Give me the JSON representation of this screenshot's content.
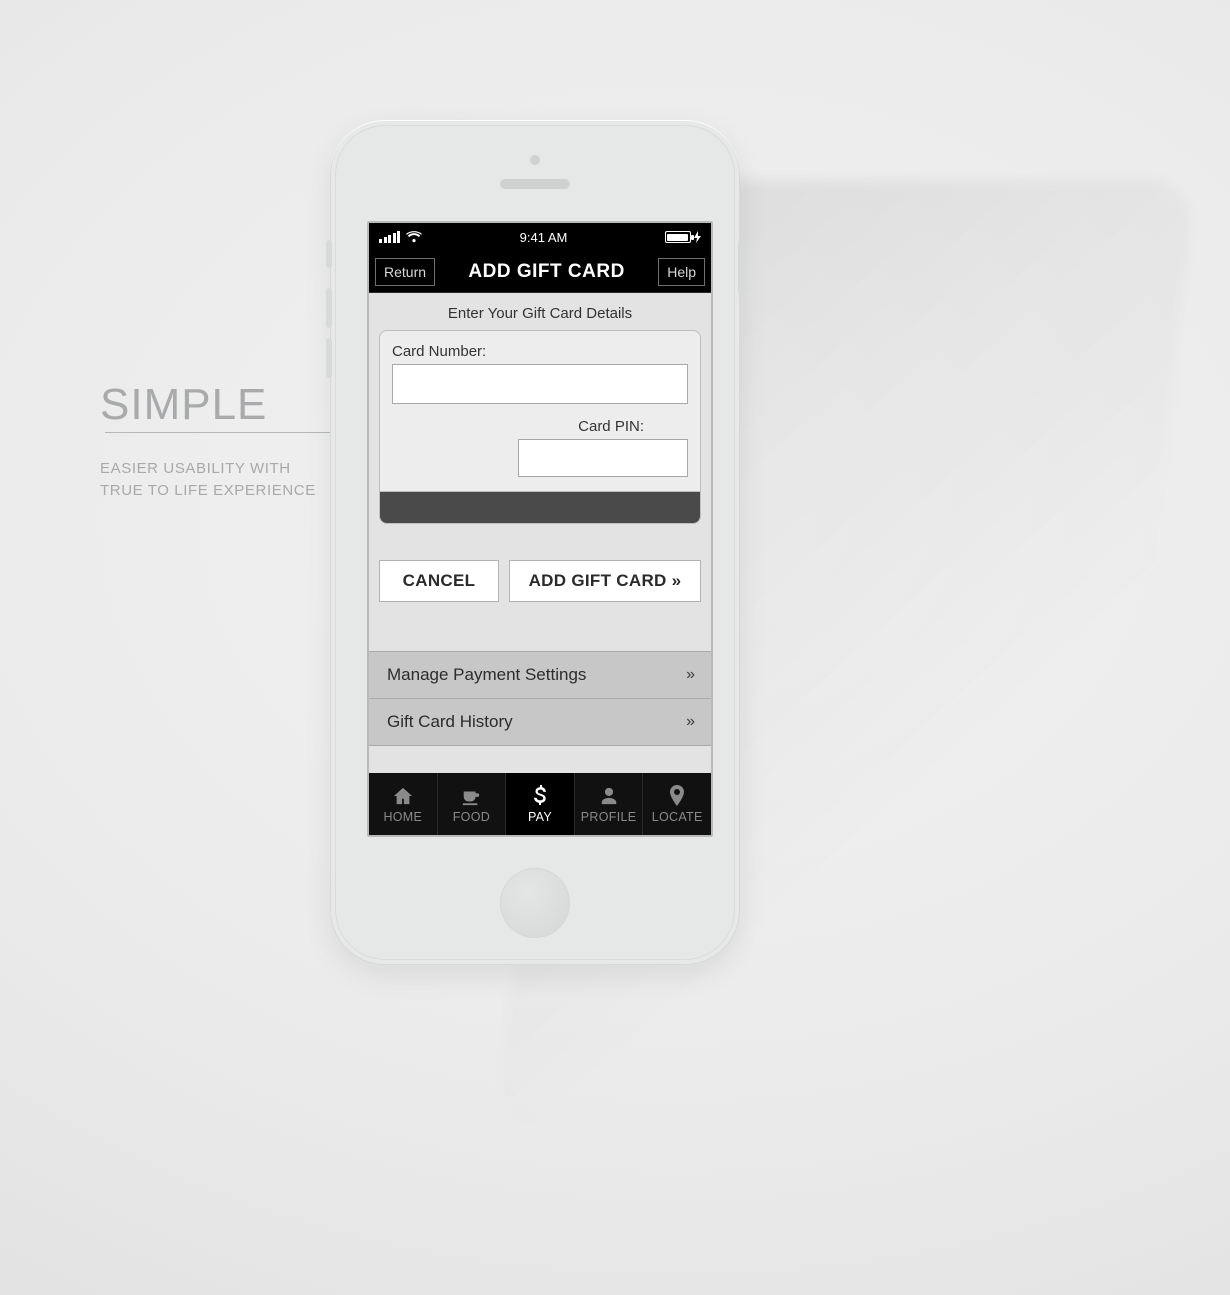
{
  "caption": {
    "title": "SIMPLE",
    "sub_line1": "EASIER USABILITY WITH",
    "sub_line2": "TRUE TO LIFE EXPERIENCE"
  },
  "statusbar": {
    "time": "9:41 AM"
  },
  "navbar": {
    "return_label": "Return",
    "title": "ADD GIFT CARD",
    "help_label": "Help"
  },
  "section": {
    "title": "Enter Your Gift Card Details"
  },
  "fields": {
    "card_number_label": "Card Number:",
    "card_number_value": "",
    "card_pin_label": "Card PIN:",
    "card_pin_value": ""
  },
  "buttons": {
    "cancel": "CANCEL",
    "add": "ADD GIFT CARD »"
  },
  "list": {
    "items": [
      {
        "label": "Manage Payment Settings",
        "chev": "»"
      },
      {
        "label": "Gift Card History",
        "chev": "»"
      }
    ]
  },
  "tabs": {
    "items": [
      {
        "label": "HOME"
      },
      {
        "label": "FOOD"
      },
      {
        "label": "PAY"
      },
      {
        "label": "PROFILE"
      },
      {
        "label": "LOCATE"
      }
    ],
    "active_index": 2
  }
}
